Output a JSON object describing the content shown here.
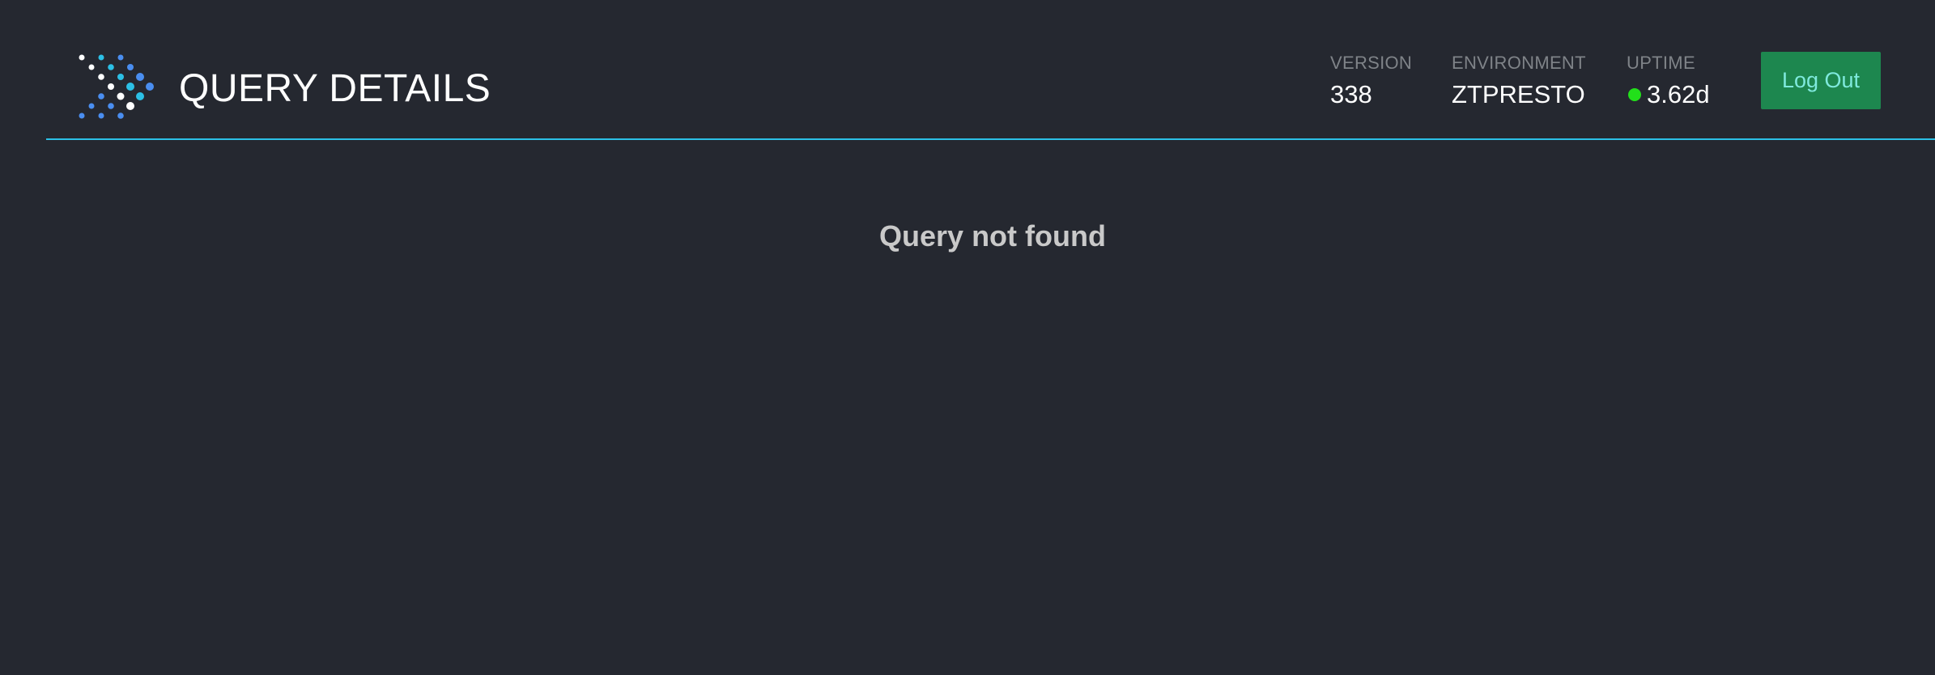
{
  "header": {
    "title": "QUERY DETAILS",
    "logo_icon": "presto-dots-logo-icon",
    "stats": {
      "version": {
        "label": "VERSION",
        "value": "338"
      },
      "environment": {
        "label": "ENVIRONMENT",
        "value": "ZTPRESTO"
      },
      "uptime": {
        "label": "UPTIME",
        "value": "3.62d",
        "status_icon": "status-dot-icon",
        "status_color": "#22e01a"
      }
    },
    "logout_label": "Log Out"
  },
  "main": {
    "message": "Query not found"
  },
  "colors": {
    "background": "#252830",
    "accent_rule": "#2cc0e6",
    "button_background": "#1d874f",
    "button_text": "#7fe9dd"
  }
}
